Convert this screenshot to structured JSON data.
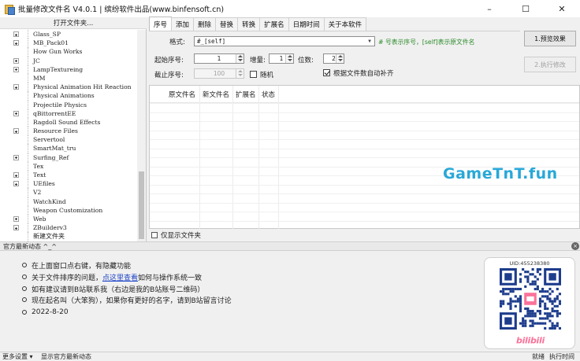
{
  "window": {
    "title": "批量修改文件名 V4.0.1 | 缤纷软件出品(www.binfensoft.cn)",
    "minimize": "–",
    "maximize": "☐",
    "close": "✕"
  },
  "left": {
    "open_folder": "打开文件夹...",
    "tree": [
      {
        "label": "Glass_SP",
        "expandable": true,
        "font": "serif"
      },
      {
        "label": "MB_Pack01",
        "expandable": true,
        "font": "serif"
      },
      {
        "label": "How Gun Works",
        "expandable": false,
        "font": "serif"
      },
      {
        "label": "JC",
        "expandable": true,
        "font": "serif"
      },
      {
        "label": "LampTextureing",
        "expandable": true,
        "font": "serif"
      },
      {
        "label": "MM",
        "expandable": false,
        "font": "serif"
      },
      {
        "label": "Physical Animation Hit Reaction",
        "expandable": true,
        "font": "serif"
      },
      {
        "label": "Physical Animations",
        "expandable": false,
        "font": "serif"
      },
      {
        "label": "Projectile Physics",
        "expandable": false,
        "font": "serif"
      },
      {
        "label": "qBittorrentEE",
        "expandable": true,
        "font": "serif"
      },
      {
        "label": "Ragdoll Sound Effects",
        "expandable": false,
        "font": "serif"
      },
      {
        "label": "Resource Files",
        "expandable": true,
        "font": "serif"
      },
      {
        "label": "Servertool",
        "expandable": false,
        "font": "serif"
      },
      {
        "label": "SmartMat_tru",
        "expandable": false,
        "font": "serif"
      },
      {
        "label": "Surfing_Ref",
        "expandable": true,
        "font": "serif"
      },
      {
        "label": "Tex",
        "expandable": false,
        "font": "serif"
      },
      {
        "label": "Text",
        "expandable": true,
        "font": "serif"
      },
      {
        "label": "UEfiles",
        "expandable": true,
        "font": "serif"
      },
      {
        "label": "V2",
        "expandable": false,
        "font": "serif"
      },
      {
        "label": "WatchKind",
        "expandable": false,
        "font": "serif"
      },
      {
        "label": "Weapon Customization",
        "expandable": false,
        "font": "serif"
      },
      {
        "label": "Web",
        "expandable": true,
        "font": "serif"
      },
      {
        "label": "ZBuilderv3",
        "expandable": true,
        "font": "serif"
      },
      {
        "label": "新建文件夹",
        "expandable": false,
        "font": "normal"
      }
    ]
  },
  "tabs": [
    "序号",
    "添加",
    "删除",
    "替换",
    "转换",
    "扩展名",
    "日期时间",
    "关于本软件"
  ],
  "form": {
    "format_label": "格式:",
    "format_value": "#_[self]",
    "format_hint": "# 号表示序号，[self]表示原文件名",
    "start_label": "起始序号:",
    "start_value": "1",
    "increment_label": "增量:",
    "increment_value": "1",
    "digits_label": "位数:",
    "digits_value": "2",
    "end_label": "截止序号:",
    "end_value": "100",
    "random_label": "随机",
    "autopad_label": "根据文件数自动补齐"
  },
  "buttons": {
    "preview": "1.预览效果",
    "execute": "2.执行修改"
  },
  "list": {
    "columns": [
      "原文件名",
      "新文件名",
      "扩展名",
      "状态"
    ]
  },
  "watermark": "GameTnT.fun",
  "show_folder_label": "仅显示文件夹",
  "news": {
    "header": "官方最新动态 ^_^",
    "close": "×",
    "items": [
      {
        "text": "在上面窗口点右键，有隐藏功能"
      },
      {
        "pre": "关于文件排序的问题，",
        "link": "点这里查看",
        "post": "如何与操作系统一致"
      },
      {
        "text": "如有建议请到B站联系我（右边是我的B站账号二维码）"
      },
      {
        "text": "现在起名叫（大笨狗），如果你有更好的名字，请到B站留言讨论"
      },
      {
        "text": "2022-8-20"
      }
    ],
    "qr_uid": "UID:455238380",
    "qr_brand": "bilibili"
  },
  "status": {
    "more_settings": "更多设置",
    "show_news": "显示官方最新动态",
    "ready": "就绪",
    "exec_time": "执行时间"
  },
  "colors": {
    "hint_green": "#2a8a2a",
    "link_blue": "#2046c8",
    "watermark": "#28a8d8",
    "bili_pink": "#fb7299",
    "qr_blue": "#1d3c8c"
  }
}
